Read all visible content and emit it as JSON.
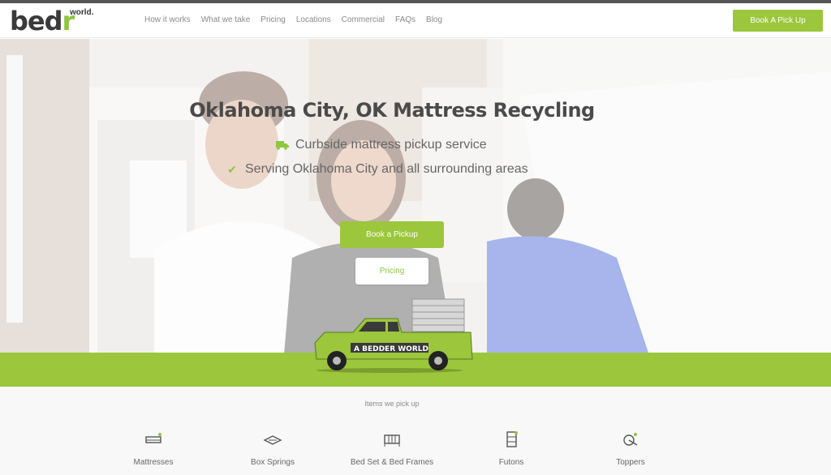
{
  "header": {
    "logo_text": "bedr",
    "logo_sub": "world.",
    "nav": [
      "How it works",
      "What we take",
      "Pricing",
      "Locations",
      "Commercial",
      "FAQs",
      "Blog"
    ],
    "cta_label": "Book A Pick Up"
  },
  "hero": {
    "title": "Oklahoma City, OK Mattress Recycling",
    "features": [
      {
        "icon": "truck-icon",
        "text": "Curbside mattress pickup service"
      },
      {
        "icon": "check-icon",
        "text": "Serving Oklahoma City and all surrounding areas"
      }
    ],
    "primary_button": "Book a Pickup",
    "secondary_button": "Pricing",
    "truck_text": "A BEDDER WORLD"
  },
  "items": {
    "title": "Items we pick up",
    "list": [
      {
        "icon": "mattress-icon",
        "label": "Mattresses"
      },
      {
        "icon": "box-spring-icon",
        "label": "Box Springs"
      },
      {
        "icon": "bed-frame-icon",
        "label": "Bed Set & Bed Frames"
      },
      {
        "icon": "futon-icon",
        "label": "Futons"
      },
      {
        "icon": "topper-icon",
        "label": "Toppers"
      }
    ]
  },
  "colors": {
    "accent": "#9cc63b",
    "text": "#4a4a4a"
  }
}
